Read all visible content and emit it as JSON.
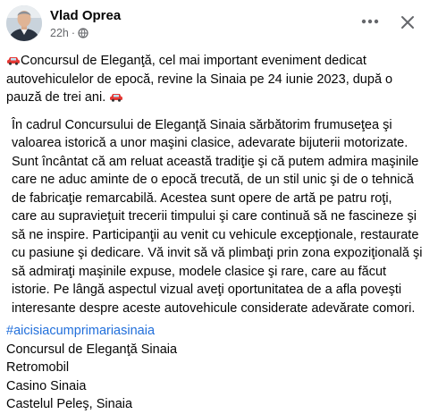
{
  "post": {
    "author": "Vlad Oprea",
    "time": "22h",
    "separator": "·",
    "privacy_icon": "globe-icon",
    "intro_lines": [
      "Concursul de Eleganţă, cel mai important eveniment dedicat",
      "autovehiculelor de epocă, revine la Sinaia pe 24 iunie 2023, după o",
      "pauză de trei ani."
    ],
    "body_lines": [
      "În cadrul Concursului de Eleganţă Sinaia sărbătorim frumuseţea şi",
      "valoarea istorică a  unor maşini clasice, adevarate bijuterii motorizate.",
      "Sunt încântat că am reluat această tradiţie şi că putem admira maşinile",
      "care ne aduc aminte de o epocă trecută, de un stil unic şi de o tehnică",
      "de fabricaţie remarcabilă. Acestea sunt opere de artă pe patru roţi,",
      "care au supravieţuit trecerii timpului şi care continuă să ne fascineze şi",
      "să ne inspire. Participanţii au venit cu vehicule excepţionale, restaurate",
      "cu pasiune şi dedicare. Vă invit să vă plimbaţi prin zona expoziţională şi",
      "să admiraţi maşinile expuse, modele clasice şi rare, care au făcut",
      "istorie. Pe lângă aspectul vizual aveţi oportunitatea  de a afla poveşti",
      "interesante despre aceste autovehicule considerate adevărate comori."
    ],
    "hashtag": "#aicisiacumprimariasinaia",
    "tags": [
      "Concursul de Eleganţă Sinaia",
      "Retromobil",
      "Casino Sinaia",
      "Castelul Peleş, Sinaia"
    ],
    "emoji_icons": [
      "red-car-emoji-icon",
      "car-emoji-icon"
    ]
  },
  "colors": {
    "text": "#050505",
    "secondary": "#65676b",
    "link": "#216fdb",
    "car_red": "#e53935"
  }
}
